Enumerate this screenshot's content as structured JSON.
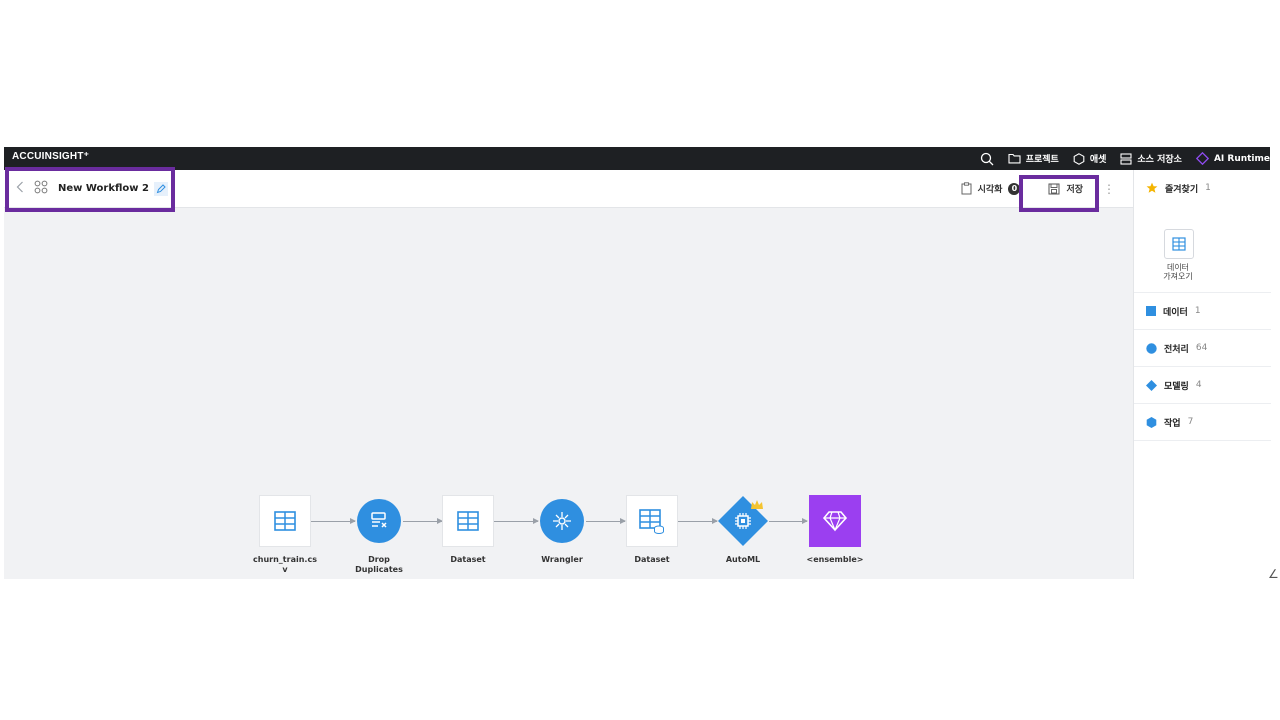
{
  "app": {
    "logo": "ACCUINSIGHT⁺",
    "nav": [
      {
        "label": "",
        "icon": "search-icon"
      },
      {
        "label": "프로젝트",
        "icon": "folder-icon"
      },
      {
        "label": "애셋",
        "icon": "hexagon-icon"
      },
      {
        "label": "소스 저장소",
        "icon": "storage-icon"
      },
      {
        "label": "AI Runtime",
        "icon": "diamond-icon"
      }
    ]
  },
  "toolbar": {
    "title": "New Workflow 2",
    "visualize_label": "시각화",
    "visualize_count": "0",
    "save_label": "저장"
  },
  "panel": {
    "favorites": {
      "label": "즐겨찾기",
      "count": "1",
      "card_label": "데이터\n가져오기"
    },
    "categories": [
      {
        "label": "데이터",
        "count": "1",
        "color": "#2f8fe0",
        "icon": "square-icon"
      },
      {
        "label": "전처리",
        "count": "64",
        "color": "#2f8fe0",
        "icon": "circle-icon"
      },
      {
        "label": "모델링",
        "count": "4",
        "color": "#2f8fe0",
        "icon": "diamond-icon"
      },
      {
        "label": "작업",
        "count": "7",
        "color": "#2f8fe0",
        "icon": "hexagon-icon"
      }
    ]
  },
  "workflow": {
    "nodes": [
      {
        "label": "churn_train.cs\nv",
        "shape": "square",
        "icon": "table-icon"
      },
      {
        "label": "Drop\nDuplicates",
        "shape": "circle",
        "icon": "drop-duplicates-icon"
      },
      {
        "label": "Dataset",
        "shape": "square",
        "icon": "table-icon"
      },
      {
        "label": "Wrangler",
        "shape": "circle",
        "icon": "wrangler-icon"
      },
      {
        "label": "Dataset",
        "shape": "square",
        "icon": "table-db-icon"
      },
      {
        "label": "AutoML",
        "shape": "diamond",
        "icon": "chip-icon"
      },
      {
        "label": "<ensemble>",
        "shape": "purple-square",
        "icon": "gem-icon"
      }
    ]
  },
  "colors": {
    "accent": "#2f8fe0",
    "highlight": "#6a2c9e",
    "ensemble": "#9b3ff0",
    "topbar": "#1e2023"
  },
  "misc": {
    "stray_glyph": "∠"
  }
}
